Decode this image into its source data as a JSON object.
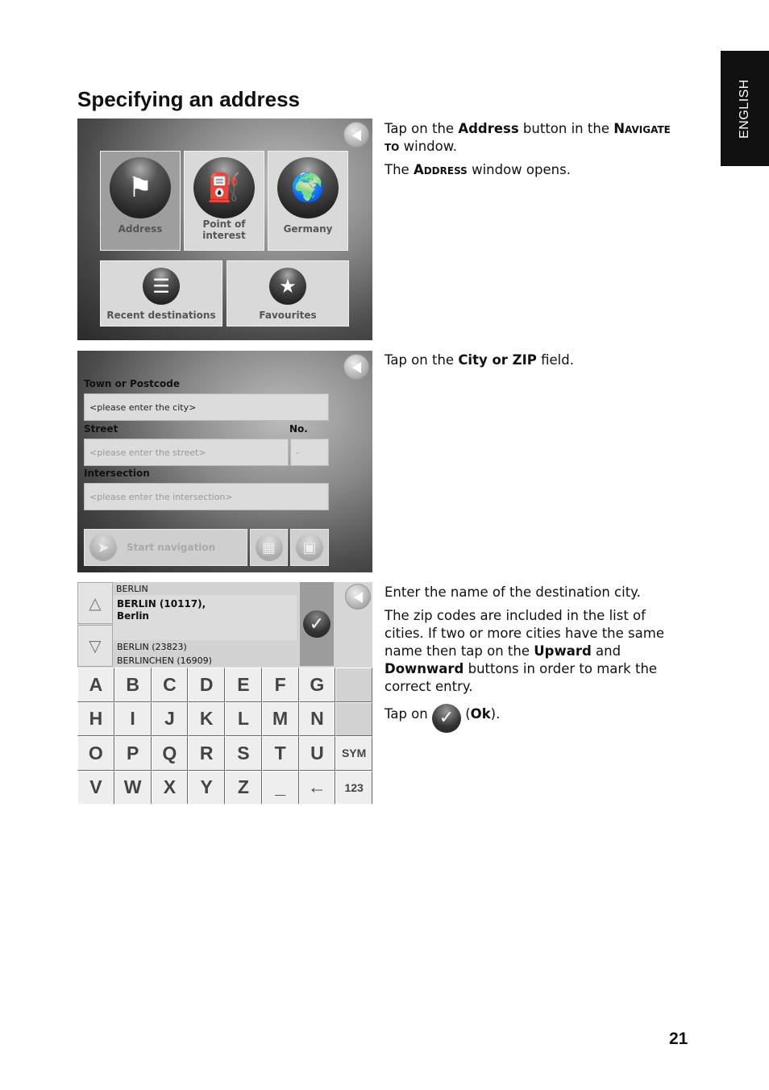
{
  "side_tab": "ENGLISH",
  "title": "Specifying an address",
  "page_number": "21",
  "screen1": {
    "buttons": [
      "Address",
      "Point of interest",
      "Germany",
      "Recent destinations",
      "Favourites"
    ],
    "icons": [
      "flag-icon",
      "fuel-pump-icon",
      "globe-icon",
      "list-icon",
      "star-icon"
    ]
  },
  "screen2": {
    "town_label": "Town or Postcode",
    "town_value": "<please enter the city>",
    "street_label": "Street",
    "no_label": "No.",
    "street_placeholder": "<please enter the street>",
    "no_placeholder": "-",
    "intersection_label": "Intersection",
    "intersection_placeholder": "<please enter the intersection>",
    "start_nav": "Start navigation"
  },
  "screen3": {
    "input": "BERLIN",
    "selected_line1": "BERLIN (10117),",
    "selected_line2": "Berlin",
    "items": [
      "BERLIN (23823)",
      "BERLINCHEN (16909)"
    ],
    "keys": [
      "A",
      "B",
      "C",
      "D",
      "E",
      "F",
      "G",
      "",
      "H",
      "I",
      "J",
      "K",
      "L",
      "M",
      "N",
      "",
      "O",
      "P",
      "Q",
      "R",
      "S",
      "T",
      "U",
      "SYM",
      "V",
      "W",
      "X",
      "Y",
      "Z",
      "_",
      "←",
      "123"
    ]
  },
  "text1": {
    "p1_a": "Tap on the ",
    "p1_b": "Address",
    "p1_c": " button in the ",
    "p1_d": "Navigate to",
    "p1_e": " window.",
    "p2_a": "The ",
    "p2_b": "Address",
    "p2_c": " window opens."
  },
  "text2": {
    "a": "Tap on the ",
    "b": "City or ZIP",
    "c": " field."
  },
  "text3": {
    "p1": "Enter the name of the destination city.",
    "p2_a": "The zip codes are included in the list of cities. If two or more cities have the same name then tap on the ",
    "p2_b": "Upward",
    "p2_c": " and ",
    "p2_d": "Downward",
    "p2_e": " buttons in order to mark the correct entry.",
    "p3_a": "Tap on ",
    "p3_b": "(",
    "p3_c": "Ok",
    "p3_d": ")."
  }
}
